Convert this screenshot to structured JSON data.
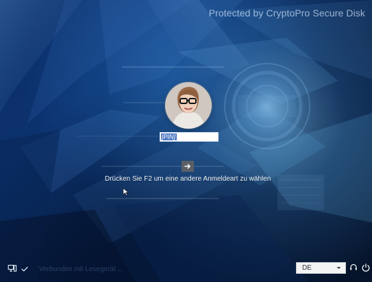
{
  "header": {
    "brand_text": "Protected by CryptoPro Secure Disk"
  },
  "login": {
    "avatar_icon": "user-avatar-icon",
    "pin_placeholder": "[PIN]",
    "submit_icon": "arrow-right-icon",
    "hint_text": "Drücken Sie F2 um eine andere Anmeldeart zu wählen"
  },
  "footer": {
    "status_text": "Verbunden mit Lesegerät ...",
    "language_value": "DE",
    "icons": {
      "computer": "computer-icon",
      "check": "check-icon",
      "dropdown": "chevron-down-icon",
      "headset": "headset-icon",
      "power": "power-icon"
    }
  },
  "colors": {
    "background_top": "#0b2d68",
    "background_bottom": "#061329",
    "selection": "#4f79c4",
    "submit_button": "#5b5f66",
    "status_text": "#466896"
  }
}
